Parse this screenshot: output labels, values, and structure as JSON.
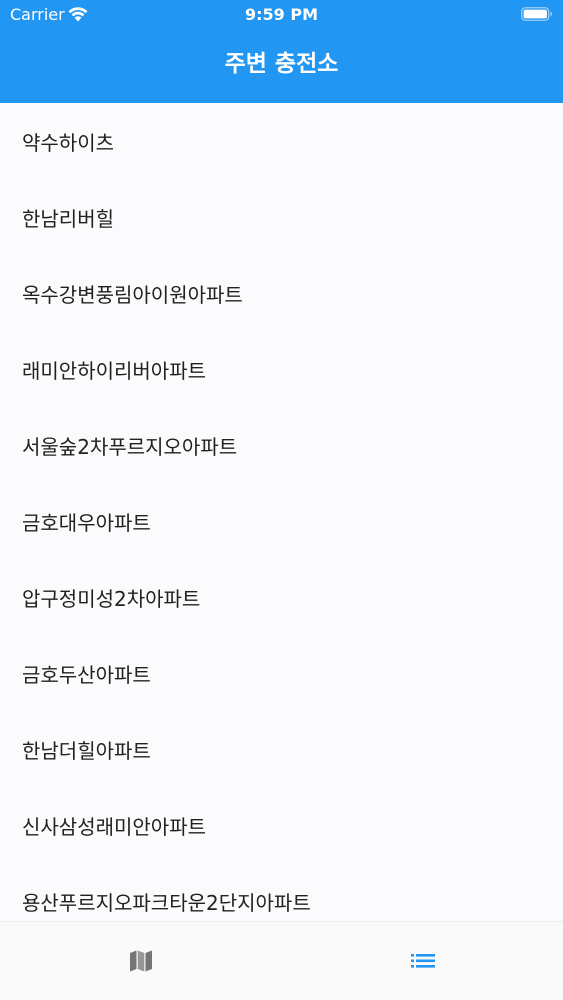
{
  "status_bar": {
    "carrier": "Carrier",
    "time": "9:59 PM"
  },
  "nav": {
    "title": "주변 충전소"
  },
  "list": {
    "items": [
      "약수하이츠",
      "한남리버힐",
      "옥수강변풍림아이원아파트",
      "래미안하이리버아파트",
      "서울숲2차푸르지오아파트",
      "금호대우아파트",
      "압구정미성2차아파트",
      "금호두산아파트",
      "한남더힐아파트",
      "신사삼성래미안아파트",
      "용산푸르지오파크타운2단지아파트"
    ]
  },
  "tab_bar": {
    "tabs": [
      {
        "icon": "map-icon",
        "active": false
      },
      {
        "icon": "list-icon",
        "active": true
      }
    ]
  },
  "colors": {
    "primary": "#2196f3",
    "inactive_icon": "#757575",
    "active_icon": "#2196f3"
  }
}
